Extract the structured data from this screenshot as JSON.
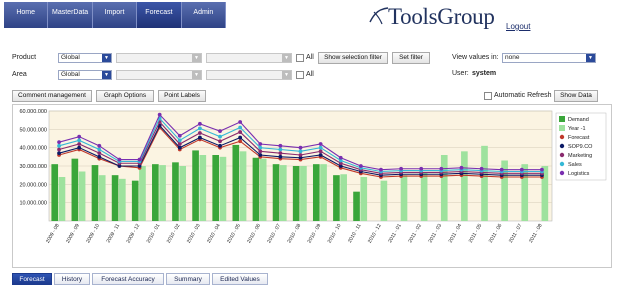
{
  "nav": {
    "tabs": [
      {
        "label": "Home",
        "active": false
      },
      {
        "label": "MasterData",
        "active": false
      },
      {
        "label": "Import",
        "active": false
      },
      {
        "label": "Forecast",
        "active": true
      },
      {
        "label": "Admin",
        "active": false
      }
    ]
  },
  "brand": {
    "name": "ToolsGroup",
    "logout_label": "Logout",
    "color": "#22335f"
  },
  "filters": {
    "product_label": "Product",
    "product_value": "Global",
    "area_label": "Area",
    "area_value": "Global",
    "all_label_1": "All",
    "all_label_2": "All",
    "show_selection_filter_label": "Show selection filter",
    "set_filter_label": "Set filter",
    "view_values_label": "View values in:",
    "view_values_value": "none",
    "user_label": "User:",
    "user_value": "system"
  },
  "toolbar": {
    "comment_management_label": "Comment management",
    "graph_options_label": "Graph Options",
    "point_labels_label": "Point Labels",
    "automatic_refresh_label": "Automatic Refresh",
    "show_data_label": "Show Data"
  },
  "bottom_tabs": [
    {
      "label": "Forecast",
      "active": true
    },
    {
      "label": "History",
      "active": false
    },
    {
      "label": "Forecast Accuracy",
      "active": false
    },
    {
      "label": "Summary",
      "active": false
    },
    {
      "label": "Edited Values",
      "active": false
    }
  ],
  "chart_data": {
    "type": "bar",
    "categories": [
      "2009 - 08",
      "2009 - 09",
      "2009 - 10",
      "2009 - 11",
      "2009 - 12",
      "2010 - 01",
      "2010 - 02",
      "2010 - 03",
      "2010 - 04",
      "2010 - 05",
      "2010 - 06",
      "2010 - 07",
      "2010 - 08",
      "2010 - 09",
      "2010 - 10",
      "2010 - 11",
      "2010 - 12",
      "2011 - 01",
      "2011 - 02",
      "2011 - 03",
      "2011 - 04",
      "2011 - 05",
      "2011 - 06",
      "2011 - 07",
      "2011 - 08"
    ],
    "yticks": [
      "10.000.000",
      "20.000.000",
      "30.000.000",
      "40.000.000",
      "50.000.000",
      "60.000.000"
    ],
    "ylim": [
      0,
      60000000
    ],
    "grid": true,
    "legend_position": "right",
    "series": [
      {
        "name": "Demand",
        "kind": "bar",
        "color": "#3aa63a",
        "values": [
          31000000,
          34000000,
          30500000,
          25000000,
          22000000,
          31000000,
          32000000,
          38500000,
          36000000,
          41500000,
          34500000,
          31000000,
          30000000,
          31000000,
          25000000,
          16000000,
          null,
          null,
          null,
          null,
          null,
          null,
          null,
          null,
          null
        ]
      },
      {
        "name": "Year -1",
        "kind": "bar",
        "color": "#9ee29e",
        "values": [
          24000000,
          27000000,
          25000000,
          23000000,
          30000000,
          30500000,
          30000000,
          36000000,
          35000000,
          38000000,
          34000000,
          30500000,
          30000000,
          31000000,
          25500000,
          24000000,
          22000000,
          25000000,
          26500000,
          36000000,
          38000000,
          41000000,
          33000000,
          31000000,
          30000000
        ]
      },
      {
        "name": "Forecast",
        "kind": "line",
        "color": "#c0392b",
        "values": [
          36000000,
          39000000,
          34000000,
          30000000,
          29000000,
          51000000,
          39000000,
          44500000,
          40000000,
          43500000,
          35000000,
          34000000,
          33500000,
          35000000,
          29000000,
          26000000,
          24000000,
          24500000,
          24500000,
          24500000,
          25000000,
          24500000,
          24000000,
          24000000,
          24000000
        ]
      },
      {
        "name": "SOP9.CO",
        "kind": "line",
        "color": "#0b1a66",
        "values": [
          37000000,
          40000000,
          35000000,
          30000000,
          30000000,
          52000000,
          40000000,
          45500000,
          41000000,
          45500000,
          36000000,
          35000000,
          34500000,
          36000000,
          30000000,
          27000000,
          25000000,
          25500000,
          25500000,
          25500000,
          26000000,
          25500000,
          25000000,
          25000000,
          25000000
        ]
      },
      {
        "name": "Marketing",
        "kind": "line",
        "color": "#8a2b6e",
        "values": [
          39000000,
          42000000,
          37000000,
          31500000,
          31500000,
          54000000,
          42000000,
          48000000,
          43500000,
          48500000,
          38000000,
          37000000,
          36000000,
          38000000,
          31500000,
          28000000,
          26000000,
          26500000,
          26500000,
          26500000,
          27000000,
          26500000,
          26000000,
          26000000,
          26000000
        ]
      },
      {
        "name": "Sales",
        "kind": "line",
        "color": "#35b8d6",
        "values": [
          41000000,
          44000000,
          39000000,
          32500000,
          32500000,
          56000000,
          44000000,
          50500000,
          46000000,
          51000000,
          40000000,
          39000000,
          38000000,
          40000000,
          33000000,
          29000000,
          27000000,
          27500000,
          27500000,
          27500000,
          28000000,
          27500000,
          27000000,
          27000000,
          27000000
        ]
      },
      {
        "name": "Logistics",
        "kind": "line",
        "color": "#7a2fb0",
        "values": [
          43000000,
          46000000,
          41000000,
          33500000,
          33500000,
          58000000,
          46500000,
          53000000,
          49000000,
          54000000,
          42000000,
          41000000,
          40000000,
          42000000,
          34500000,
          30000000,
          28000000,
          28500000,
          28500000,
          28500000,
          29000000,
          28500000,
          28000000,
          28000000,
          28000000
        ]
      }
    ]
  }
}
